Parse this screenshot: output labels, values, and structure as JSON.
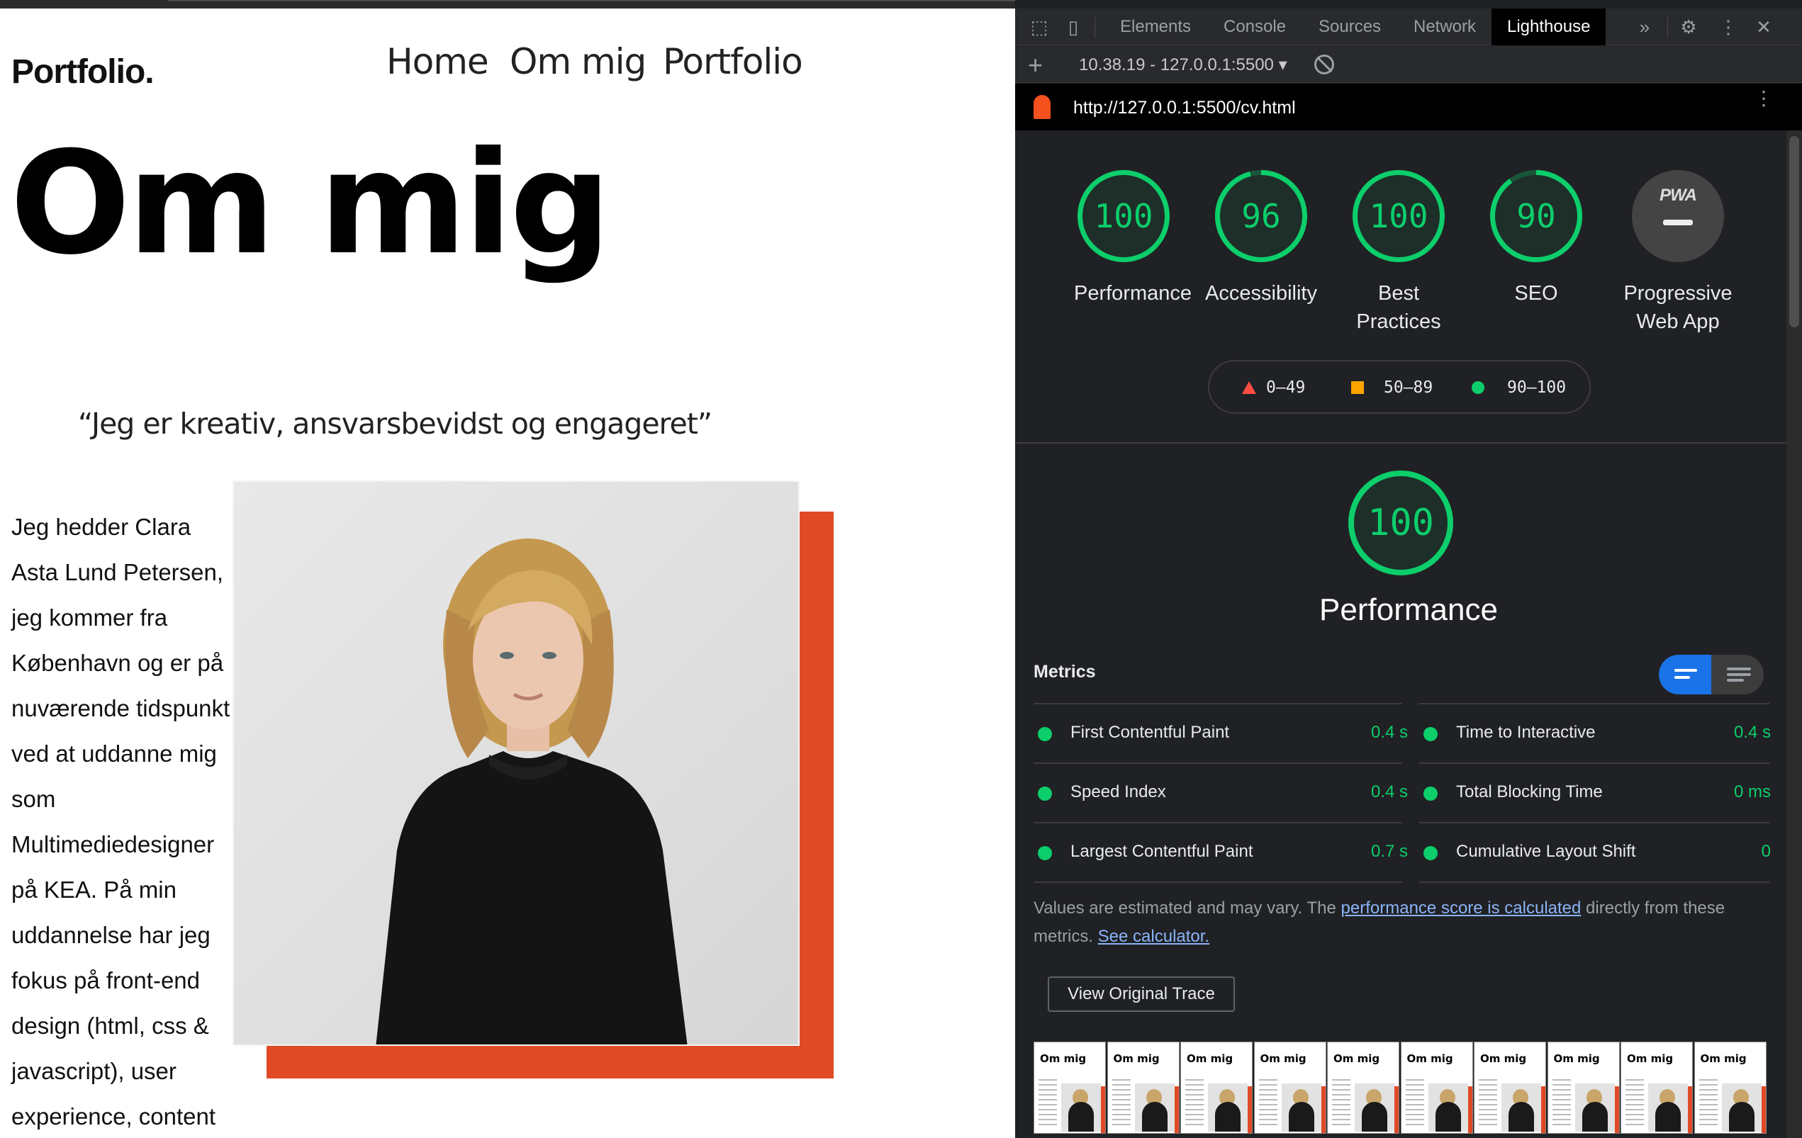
{
  "site": {
    "logo": "Portfolio.",
    "nav": [
      "Home",
      "Om mig",
      "Portfolio"
    ],
    "title": "Om mig",
    "quote": "“Jeg er kreativ, ansvarsbevidst og engageret”",
    "bio_lines": [
      "Jeg hedder Clara",
      "Asta Lund Petersen,",
      "jeg kommer fra",
      "København og er på",
      "nuværende tidspunkt",
      "ved at uddanne mig",
      "som",
      "Multimediedesigner",
      "på KEA. På min",
      "uddannelse har jeg",
      "fokus på front-end",
      "design (html, css &",
      "javascript), user",
      "experience, content"
    ],
    "accent_color": "#e04a26"
  },
  "devtools": {
    "tabs": [
      "Elements",
      "Console",
      "Sources",
      "Network",
      "Lighthouse"
    ],
    "active_tab": "Lighthouse",
    "more_tabs_icon": "double-chevron-icon",
    "report_select": "10.38.19 - 127.0.0.1:5500",
    "url": "http://127.0.0.1:5500/cv.html",
    "gauges": [
      {
        "label": "Performance",
        "score": "100",
        "fraction": 1.0
      },
      {
        "label": "Accessibility",
        "score": "96",
        "fraction": 0.96
      },
      {
        "label": "Best Practices",
        "score": "100",
        "fraction": 1.0
      },
      {
        "label": "SEO",
        "score": "90",
        "fraction": 0.9
      },
      {
        "label": "Progressive Web App",
        "score": "PWA",
        "fraction": null
      }
    ],
    "legend": {
      "fail": "0–49",
      "average": "50–89",
      "pass": "90–100"
    },
    "section_score": "100",
    "section_title": "Performance",
    "metrics_heading": "Metrics",
    "metrics": [
      {
        "name": "First Contentful Paint",
        "value": "0.4 s"
      },
      {
        "name": "Time to Interactive",
        "value": "0.4 s"
      },
      {
        "name": "Speed Index",
        "value": "0.4 s"
      },
      {
        "name": "Total Blocking Time",
        "value": "0 ms"
      },
      {
        "name": "Largest Contentful Paint",
        "value": "0.7 s"
      },
      {
        "name": "Cumulative Layout Shift",
        "value": "0"
      }
    ],
    "note_pre": "Values are estimated and may vary. The ",
    "note_link1": "performance score is calculated",
    "note_mid": " directly from these metrics. ",
    "note_link2": "See calculator.",
    "trace_button": "View Original Trace",
    "filmstrip_title": "Om mig",
    "colors": {
      "pass": "#0cce6b",
      "average": "#ffa400",
      "fail": "#ff4e42",
      "accent": "#1a73e8"
    }
  }
}
